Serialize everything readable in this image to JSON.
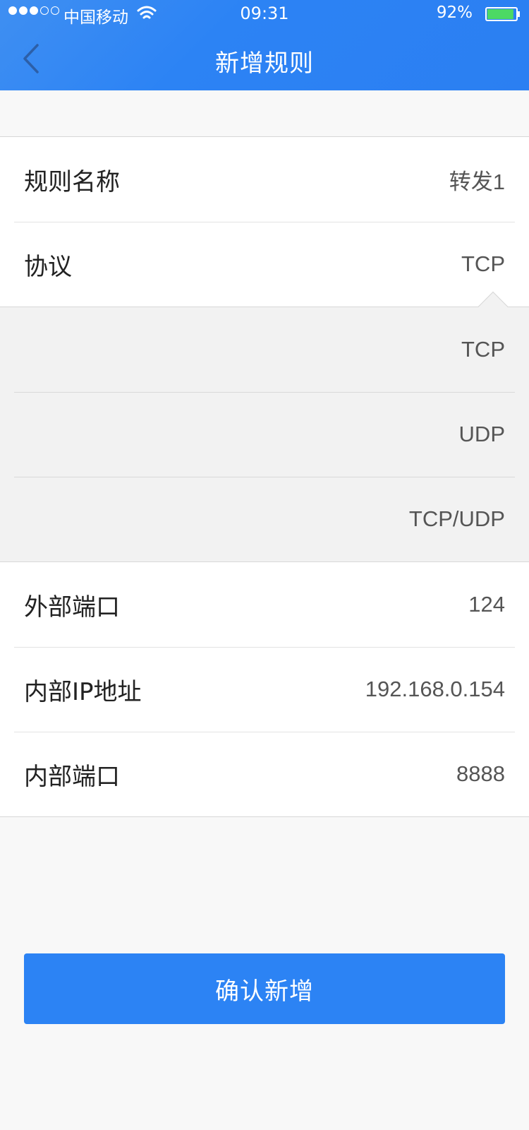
{
  "status_bar": {
    "carrier": "中国移动",
    "time": "09:31",
    "battery": "92%",
    "battery_level": 0.92,
    "signal_bars_filled": 3,
    "signal_bars_total": 5
  },
  "nav": {
    "title": "新增规则",
    "back_icon": "chevron-left-icon"
  },
  "form": {
    "rule_name": {
      "label": "规则名称",
      "value": "转发1"
    },
    "protocol": {
      "label": "协议",
      "value": "TCP"
    },
    "protocol_options": [
      "TCP",
      "UDP",
      "TCP/UDP"
    ],
    "external_port": {
      "label": "外部端口",
      "value": "124"
    },
    "internal_ip": {
      "label": "内部IP地址",
      "value": "192.168.0.154"
    },
    "internal_port": {
      "label": "内部端口",
      "value": "8888"
    }
  },
  "confirm_label": "确认新增",
  "colors": {
    "primary": "#2c83f4",
    "battery_fill": "#4cd964"
  }
}
